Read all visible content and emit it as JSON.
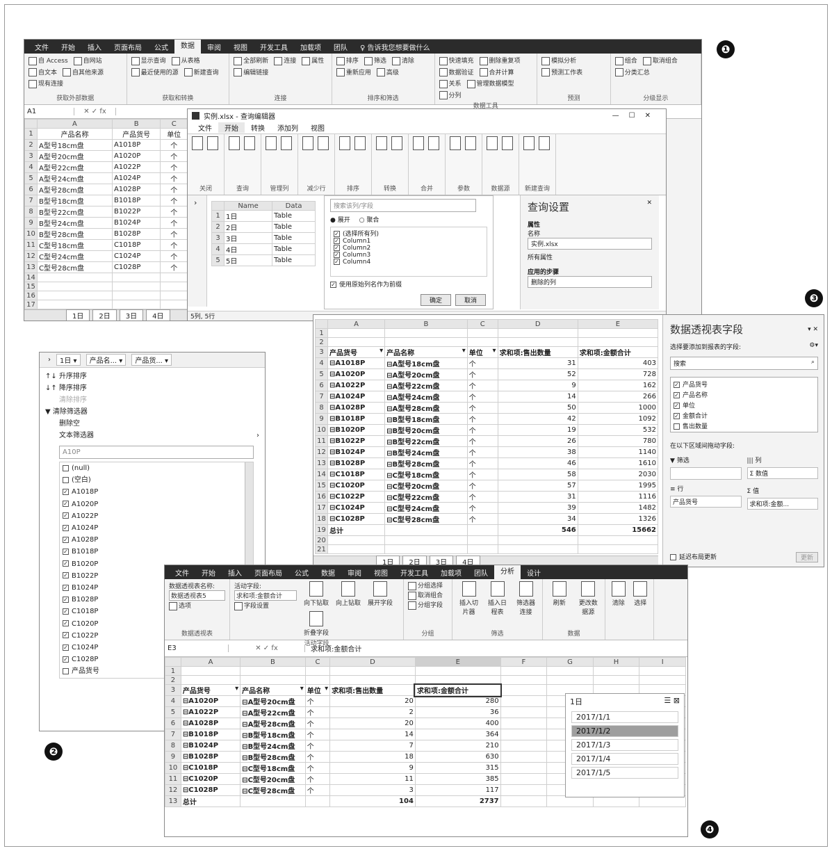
{
  "badges": [
    "❶",
    "❷",
    "❸",
    "❹"
  ],
  "w1": {
    "tabs": [
      "文件",
      "开始",
      "插入",
      "页面布局",
      "公式",
      "数据",
      "审阅",
      "视图",
      "开发工具",
      "加载项",
      "团队",
      "♀ 告诉我您想要做什么"
    ],
    "ribbon_groups": [
      {
        "name": "获取外部数据",
        "items": [
          "自 Access",
          "自网站",
          "自文本",
          "自其他来源",
          "现有连接"
        ]
      },
      {
        "name": "获取和转换",
        "items": [
          "显示查询",
          "从表格",
          "最近使用的源",
          "新建查询"
        ]
      },
      {
        "name": "连接",
        "items": [
          "全部刷新",
          "连接",
          "属性",
          "编辑链接"
        ]
      },
      {
        "name": "排序和筛选",
        "items": [
          "排序",
          "筛选",
          "清除",
          "重新应用",
          "高级"
        ]
      },
      {
        "name": "数据工具",
        "items": [
          "快速填充",
          "删除重复项",
          "数据验证",
          "合并计算",
          "关系",
          "管理数据模型",
          "分列"
        ]
      },
      {
        "name": "预测",
        "items": [
          "模拟分析",
          "预测工作表"
        ]
      },
      {
        "name": "分级显示",
        "items": [
          "组合",
          "取消组合",
          "分类汇总"
        ]
      }
    ],
    "namebox": "A1",
    "col_headers": [
      "A",
      "B",
      "C"
    ],
    "header_row": [
      "产品名称",
      "产品货号",
      "单位"
    ],
    "rows": [
      [
        "A型号18cm盘",
        "A1018P",
        "个"
      ],
      [
        "A型号20cm盘",
        "A1020P",
        "个"
      ],
      [
        "A型号22cm盘",
        "A1022P",
        "个"
      ],
      [
        "A型号24cm盘",
        "A1024P",
        "个"
      ],
      [
        "A型号28cm盘",
        "A1028P",
        "个"
      ],
      [
        "B型号18cm盘",
        "B1018P",
        "个"
      ],
      [
        "B型号22cm盘",
        "B1022P",
        "个"
      ],
      [
        "B型号24cm盘",
        "B1024P",
        "个"
      ],
      [
        "B型号28cm盘",
        "B1028P",
        "个"
      ],
      [
        "C型号18cm盘",
        "C1018P",
        "个"
      ],
      [
        "C型号24cm盘",
        "C1024P",
        "个"
      ],
      [
        "C型号28cm盘",
        "C1028P",
        "个"
      ]
    ],
    "sheet_tabs": [
      "1日",
      "2日",
      "3日",
      "4日"
    ]
  },
  "qe": {
    "title": "实例.xlsx - 查询编辑器",
    "tabs": [
      "文件",
      "开始",
      "转换",
      "添加列",
      "视图"
    ],
    "groups": [
      "关闭",
      "查询",
      "管理列",
      "减少行",
      "排序",
      "转换",
      "合并",
      "参数",
      "数据源",
      "新建查询"
    ],
    "table_headers": [
      "Name",
      "Data"
    ],
    "table_rows": [
      [
        "1日",
        "Table"
      ],
      [
        "2日",
        "Table"
      ],
      [
        "3日",
        "Table"
      ],
      [
        "4日",
        "Table"
      ],
      [
        "5日",
        "Table"
      ]
    ],
    "filter_search": "搜索该列/字段",
    "expand_label": "展开",
    "aggregate_label": "聚合",
    "select_all": "(选择所有列)",
    "columns": [
      "Column1",
      "Column2",
      "Column3",
      "Column4"
    ],
    "use_prefix": "使用原始列名作为前缀",
    "ok": "确定",
    "cancel": "取消",
    "status": "5列, 5行",
    "settings_title": "查询设置",
    "props": "属性",
    "name_label": "名称",
    "name_value": "实例.xlsx",
    "all_props": "所有属性",
    "applied_steps": "应用的步骤",
    "step": "删除的列",
    "query_tag": "新建查询"
  },
  "w2": {
    "header": [
      "1日",
      "产品名...",
      "产品货..."
    ],
    "sort_asc": "升序排序",
    "sort_desc": "降序排序",
    "clear_sort": "清除排序",
    "clear_filter": "清除筛选器",
    "remove_empty": "删除空",
    "text_filter": "文本筛选器",
    "search": "A10P",
    "items": [
      {
        "label": "(null)",
        "checked": false
      },
      {
        "label": "(空白)",
        "checked": false
      },
      {
        "label": "A1018P",
        "checked": true
      },
      {
        "label": "A1020P",
        "checked": true
      },
      {
        "label": "A1022P",
        "checked": true
      },
      {
        "label": "A1024P",
        "checked": true
      },
      {
        "label": "A1028P",
        "checked": true
      },
      {
        "label": "B1018P",
        "checked": true
      },
      {
        "label": "B1020P",
        "checked": true
      },
      {
        "label": "B1022P",
        "checked": true
      },
      {
        "label": "B1024P",
        "checked": true
      },
      {
        "label": "B1028P",
        "checked": true
      },
      {
        "label": "C1018P",
        "checked": true
      },
      {
        "label": "C1020P",
        "checked": true
      },
      {
        "label": "C1022P",
        "checked": true
      },
      {
        "label": "C1024P",
        "checked": true
      },
      {
        "label": "C1028P",
        "checked": true
      },
      {
        "label": "产品货号",
        "checked": false
      }
    ]
  },
  "w3": {
    "col_headers": [
      "A",
      "B",
      "C",
      "D",
      "E"
    ],
    "header_row": [
      "产品货号",
      "产品名称",
      "单位",
      "求和项:售出数量",
      "求和项:金额合计"
    ],
    "rows": [
      [
        "A1018P",
        "A型号18cm盘",
        "个",
        "31",
        "403"
      ],
      [
        "A1020P",
        "A型号20cm盘",
        "个",
        "52",
        "728"
      ],
      [
        "A1022P",
        "A型号22cm盘",
        "个",
        "9",
        "162"
      ],
      [
        "A1024P",
        "A型号24cm盘",
        "个",
        "14",
        "266"
      ],
      [
        "A1028P",
        "A型号28cm盘",
        "个",
        "50",
        "1000"
      ],
      [
        "B1018P",
        "B型号18cm盘",
        "个",
        "42",
        "1092"
      ],
      [
        "B1020P",
        "B型号20cm盘",
        "个",
        "19",
        "532"
      ],
      [
        "B1022P",
        "B型号22cm盘",
        "个",
        "26",
        "780"
      ],
      [
        "B1024P",
        "B型号24cm盘",
        "个",
        "38",
        "1140"
      ],
      [
        "B1028P",
        "B型号28cm盘",
        "个",
        "46",
        "1610"
      ],
      [
        "C1018P",
        "C型号18cm盘",
        "个",
        "58",
        "2030"
      ],
      [
        "C1020P",
        "C型号20cm盘",
        "个",
        "57",
        "1995"
      ],
      [
        "C1022P",
        "C型号22cm盘",
        "个",
        "31",
        "1116"
      ],
      [
        "C1024P",
        "C型号24cm盘",
        "个",
        "39",
        "1482"
      ],
      [
        "C1028P",
        "C型号28cm盘",
        "个",
        "34",
        "1326"
      ]
    ],
    "total": [
      "总计",
      "546",
      "15662"
    ],
    "sheet_tabs": [
      "1日",
      "2日",
      "3日",
      "4日"
    ],
    "field_panel_title": "数据透视表字段",
    "choose_fields": "选择要添加到报表的字段:",
    "search": "搜索",
    "fields": [
      {
        "label": "产品货号",
        "checked": true
      },
      {
        "label": "产品名称",
        "checked": true
      },
      {
        "label": "单位",
        "checked": true
      },
      {
        "label": "金额合计",
        "checked": true
      },
      {
        "label": "售出数量",
        "checked": false
      }
    ],
    "drag_hint": "在以下区域间拖动字段:",
    "area_filter": "筛选",
    "area_columns": "列",
    "area_rows": "行",
    "area_values": "值",
    "col_value": "Σ 数值",
    "row_value": "产品货号",
    "val_value": "求和项:金额...",
    "defer": "延迟布局更新",
    "update": "更新"
  },
  "w4": {
    "tabs": [
      "文件",
      "开始",
      "插入",
      "页面布局",
      "公式",
      "数据",
      "审阅",
      "视图",
      "开发工具",
      "加载项",
      "团队",
      "分析",
      "设计"
    ],
    "pt_name_label": "数据透视表名称:",
    "pt_name": "数据透视表5",
    "active_field_label": "活动字段:",
    "active_field": "求和项:金额合计",
    "options": "选项",
    "field_settings": "字段设置",
    "groups": [
      "数据透视表",
      "活动字段",
      "分组",
      "筛选",
      "数据"
    ],
    "drill": [
      "向下钻取",
      "向上钻取",
      "展开字段",
      "折叠字段"
    ],
    "group_btns": [
      "分组选择",
      "取消组合",
      "分组字段"
    ],
    "filter_btns": [
      "插入切片器",
      "插入日程表",
      "筛选器连接"
    ],
    "data_btns": [
      "刷新",
      "更改数据源"
    ],
    "action_btns": [
      "清除",
      "选择"
    ],
    "namebox": "E3",
    "formula": "求和项:金额合计",
    "col_headers": [
      "A",
      "B",
      "C",
      "D",
      "E",
      "F",
      "G",
      "H",
      "I"
    ],
    "header_row": [
      "产品货号",
      "产品名称",
      "单位",
      "求和项:售出数量",
      "求和项:金额合计"
    ],
    "rows": [
      [
        "A1020P",
        "A型号20cm盘",
        "个",
        "20",
        "280"
      ],
      [
        "A1022P",
        "A型号22cm盘",
        "个",
        "2",
        "36"
      ],
      [
        "A1028P",
        "A型号28cm盘",
        "个",
        "20",
        "400"
      ],
      [
        "B1018P",
        "B型号18cm盘",
        "个",
        "14",
        "364"
      ],
      [
        "B1024P",
        "B型号24cm盘",
        "个",
        "7",
        "210"
      ],
      [
        "B1028P",
        "B型号28cm盘",
        "个",
        "18",
        "630"
      ],
      [
        "C1018P",
        "C型号18cm盘",
        "个",
        "9",
        "315"
      ],
      [
        "C1020P",
        "C型号20cm盘",
        "个",
        "11",
        "385"
      ],
      [
        "C1028P",
        "C型号28cm盘",
        "个",
        "3",
        "117"
      ]
    ],
    "total": [
      "总计",
      "104",
      "2737"
    ],
    "slicer_title": "1日",
    "slicer_items": [
      {
        "label": "2017/1/1",
        "selected": false
      },
      {
        "label": "2017/1/2",
        "selected": true
      },
      {
        "label": "2017/1/3",
        "selected": false
      },
      {
        "label": "2017/1/4",
        "selected": false
      },
      {
        "label": "2017/1/5",
        "selected": false
      }
    ]
  }
}
